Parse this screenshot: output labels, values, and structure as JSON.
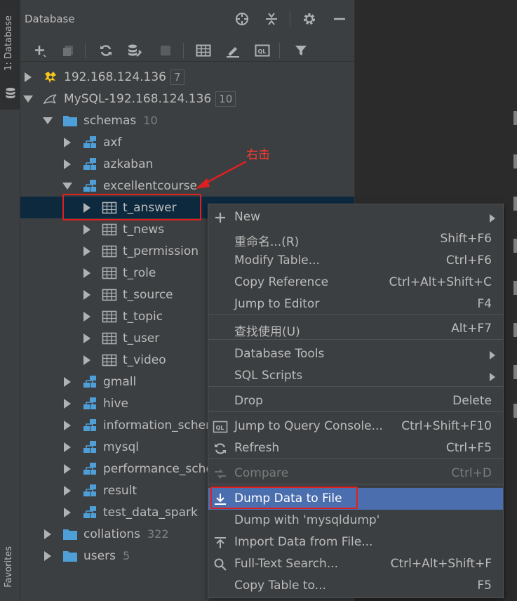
{
  "strip": {
    "database_tab": "1: Database",
    "favorites_tab": "Favorites"
  },
  "panel": {
    "title": "Database",
    "header_icons": [
      "crosshair-icon",
      "collapse-icon",
      "gear-icon",
      "minimize-icon"
    ],
    "toolbar_icons": [
      "add-icon",
      "duplicate-icon",
      "refresh-icon",
      "schema-tools-icon",
      "stop-icon",
      "table-view-icon",
      "edit-icon",
      "query-console-icon",
      "filter-icon"
    ]
  },
  "tree": [
    {
      "label": "192.168.124.136",
      "count": "7",
      "icon": "connection-icon",
      "expanded": false
    },
    {
      "label": "MySQL-192.168.124.136",
      "count": "10",
      "icon": "mysql-dolphin-icon",
      "expanded": true
    },
    {
      "label": "schemas",
      "count": "10",
      "icon": "folder-icon",
      "expanded": true
    },
    {
      "label": "axf",
      "icon": "schema-icon",
      "expanded": false
    },
    {
      "label": "azkaban",
      "icon": "schema-icon",
      "expanded": false
    },
    {
      "label": "excellentcourse",
      "icon": "schema-icon",
      "expanded": true
    },
    {
      "label": "t_answer",
      "icon": "table-icon",
      "expanded": false
    },
    {
      "label": "t_news",
      "icon": "table-icon",
      "expanded": false
    },
    {
      "label": "t_permission",
      "icon": "table-icon",
      "expanded": false
    },
    {
      "label": "t_role",
      "icon": "table-icon",
      "expanded": false
    },
    {
      "label": "t_source",
      "icon": "table-icon",
      "expanded": false
    },
    {
      "label": "t_topic",
      "icon": "table-icon",
      "expanded": false
    },
    {
      "label": "t_user",
      "icon": "table-icon",
      "expanded": false
    },
    {
      "label": "t_video",
      "icon": "table-icon",
      "expanded": false
    },
    {
      "label": "gmall",
      "icon": "schema-icon",
      "expanded": false
    },
    {
      "label": "hive",
      "icon": "schema-icon",
      "expanded": false
    },
    {
      "label": "information_schema",
      "icon": "schema-icon",
      "expanded": false
    },
    {
      "label": "mysql",
      "icon": "schema-icon",
      "expanded": false
    },
    {
      "label": "performance_schema",
      "icon": "schema-icon",
      "expanded": false
    },
    {
      "label": "result",
      "icon": "schema-icon",
      "expanded": false
    },
    {
      "label": "test_data_spark",
      "icon": "schema-icon",
      "expanded": false
    },
    {
      "label": "collations",
      "count": "322",
      "icon": "folder-icon",
      "expanded": false
    },
    {
      "label": "users",
      "count": "5",
      "icon": "folder-icon",
      "expanded": false
    }
  ],
  "annotation": "右击",
  "menu": {
    "items": [
      {
        "label": "New",
        "shortcut": "",
        "submenu": true,
        "icon": "plus-icon"
      },
      {
        "label": "重命名...(R)",
        "shortcut": "Shift+F6"
      },
      {
        "label": "Modify Table...",
        "shortcut": "Ctrl+F6"
      },
      {
        "label": "Copy Reference",
        "shortcut": "Ctrl+Alt+Shift+C"
      },
      {
        "label": "Jump to Editor",
        "shortcut": "F4"
      },
      {
        "label": "查找使用(U)",
        "shortcut": "Alt+F7"
      },
      {
        "label": "Database Tools",
        "shortcut": "",
        "submenu": true
      },
      {
        "label": "SQL Scripts",
        "shortcut": "",
        "submenu": true
      },
      {
        "label": "Drop",
        "shortcut": "Delete"
      },
      {
        "label": "Jump to Query Console...",
        "shortcut": "Ctrl+Shift+F10",
        "icon": "query-console-icon"
      },
      {
        "label": "Refresh",
        "shortcut": "Ctrl+F5",
        "icon": "refresh-icon"
      },
      {
        "label": "Compare",
        "shortcut": "Ctrl+D",
        "icon": "compare-icon",
        "disabled": true
      },
      {
        "label": "Dump Data to File",
        "shortcut": "",
        "icon": "download-icon",
        "highlighted": true
      },
      {
        "label": "Dump with 'mysqldump'",
        "shortcut": ""
      },
      {
        "label": "Import Data from File...",
        "shortcut": "",
        "icon": "upload-icon"
      },
      {
        "label": "Full-Text Search...",
        "shortcut": "Ctrl+Alt+Shift+F",
        "icon": "search-icon"
      },
      {
        "label": "Copy Table to...",
        "shortcut": "F5"
      }
    ]
  },
  "colors": {
    "highlight": "#4b6eaf",
    "selection": "#0d293e",
    "annotation": "#e02020",
    "schema_icon": "#4e9fd8"
  }
}
